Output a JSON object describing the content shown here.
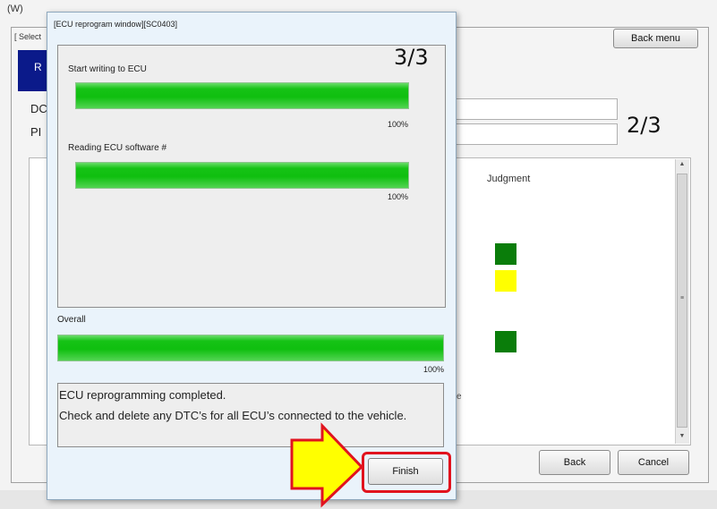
{
  "background": {
    "menu_text": "(W)",
    "select_label": "[ Select",
    "blue_tab_label": "R",
    "field1_label": "DC",
    "field2_label": "PI",
    "step_indicator": "2/3",
    "judgment_label": "Judgment",
    "back_menu_label": "Back menu",
    "back_label": "Back",
    "cancel_label": "Cancel",
    "hidden_fragment": "e",
    "status_colors": [
      "#0a7d0a",
      "#ffff00",
      "#0a7d0a"
    ]
  },
  "dialog": {
    "title": "[ECU reprogram window][SC0403]",
    "step": "3/3",
    "tasks": [
      {
        "label": "Start writing to ECU",
        "progress": 100,
        "percent_text": "100%"
      },
      {
        "label": "Reading ECU software #",
        "progress": 100,
        "percent_text": "100%"
      }
    ],
    "overall": {
      "label": "Overall",
      "progress": 100,
      "percent_text": "100%"
    },
    "message_lines": [
      "ECU reprogramming completed.",
      "Check and delete any DTC’s for all ECU’s connected to the vehicle."
    ],
    "finish_label": "Finish"
  },
  "annotation": {
    "arrow_color": "#ffff00",
    "arrow_outline": "#e1131e",
    "highlight_color": "#e1131e"
  }
}
